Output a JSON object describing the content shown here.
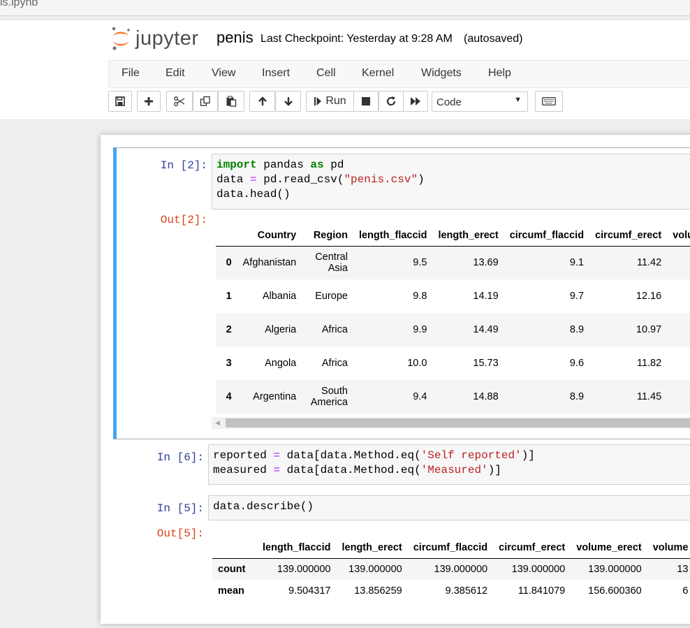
{
  "browser": {
    "tab_title": "is.ipynb"
  },
  "header": {
    "logo_text": "jupyter",
    "notebook_name": "penis",
    "checkpoint": "Last Checkpoint: Yesterday at 9:28 AM",
    "autosave": "(autosaved)"
  },
  "menu": [
    "File",
    "Edit",
    "View",
    "Insert",
    "Cell",
    "Kernel",
    "Widgets",
    "Help"
  ],
  "toolbar": {
    "run_label": "Run",
    "cell_type": "Code",
    "icons": [
      "save-icon",
      "plus-icon",
      "scissors-icon",
      "copy-icon",
      "paste-icon",
      "arrow-up-icon",
      "arrow-down-icon",
      "step-icon",
      "stop-icon",
      "restart-icon",
      "fast-forward-icon",
      "keyboard-icon"
    ]
  },
  "cells": {
    "c1": {
      "in_prompt": "In [2]:",
      "out_prompt": "Out[2]:",
      "code": [
        "import pandas as pd",
        "data = pd.read_csv(\"penis.csv\")",
        "data.head()"
      ],
      "table": {
        "columns": [
          "",
          "Country",
          "Region",
          "length_flaccid",
          "length_erect",
          "circumf_flaccid",
          "circumf_erect",
          "volu"
        ],
        "rows": [
          [
            "0",
            "Afghanistan",
            "Central Asia",
            "9.5",
            "13.69",
            "9.1",
            "11.42",
            ""
          ],
          [
            "1",
            "Albania",
            "Europe",
            "9.8",
            "14.19",
            "9.7",
            "12.16",
            ""
          ],
          [
            "2",
            "Algeria",
            "Africa",
            "9.9",
            "14.49",
            "8.9",
            "10.97",
            ""
          ],
          [
            "3",
            "Angola",
            "Africa",
            "10.0",
            "15.73",
            "9.6",
            "11.82",
            ""
          ],
          [
            "4",
            "Argentina",
            "South America",
            "9.4",
            "14.88",
            "8.9",
            "11.45",
            ""
          ]
        ]
      }
    },
    "c2": {
      "in_prompt": "In [6]:",
      "code": [
        "reported = data[data.Method.eq('Self reported')]",
        "measured = data[data.Method.eq('Measured')]"
      ]
    },
    "c3": {
      "in_prompt": "In [5]:",
      "out_prompt": "Out[5]:",
      "code": [
        "data.describe()"
      ],
      "table": {
        "columns": [
          "",
          "length_flaccid",
          "length_erect",
          "circumf_flaccid",
          "circumf_erect",
          "volume_erect",
          "volume"
        ],
        "rows": [
          [
            "count",
            "139.000000",
            "139.000000",
            "139.000000",
            "139.000000",
            "139.000000",
            "13"
          ],
          [
            "mean",
            "9.504317",
            "13.856259",
            "9.385612",
            "11.841079",
            "156.600360",
            "6"
          ]
        ]
      }
    }
  }
}
